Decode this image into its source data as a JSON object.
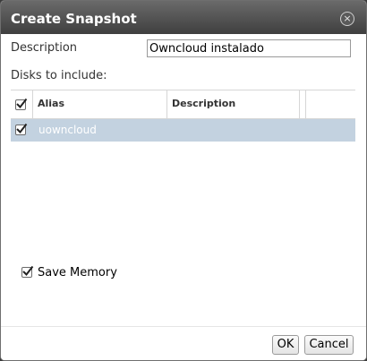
{
  "dialog": {
    "title": "Create Snapshot"
  },
  "form": {
    "description_label": "Description",
    "description_value": "Owncloud instalado",
    "disks_label": "Disks to include:"
  },
  "disks_table": {
    "columns": [
      "Alias",
      "Description"
    ],
    "select_all_checked": true,
    "rows": [
      {
        "alias": "uowncloud",
        "description": "",
        "checked": true
      }
    ]
  },
  "memory": {
    "label": "Save Memory",
    "checked": true
  },
  "footer": {
    "ok_label": "OK",
    "cancel_label": "Cancel"
  },
  "colors": {
    "titlebar": "#4f4f4f",
    "selected_row": "#c3d2e0"
  },
  "icons": {
    "close": "close-icon",
    "check": "checkmark-icon"
  }
}
